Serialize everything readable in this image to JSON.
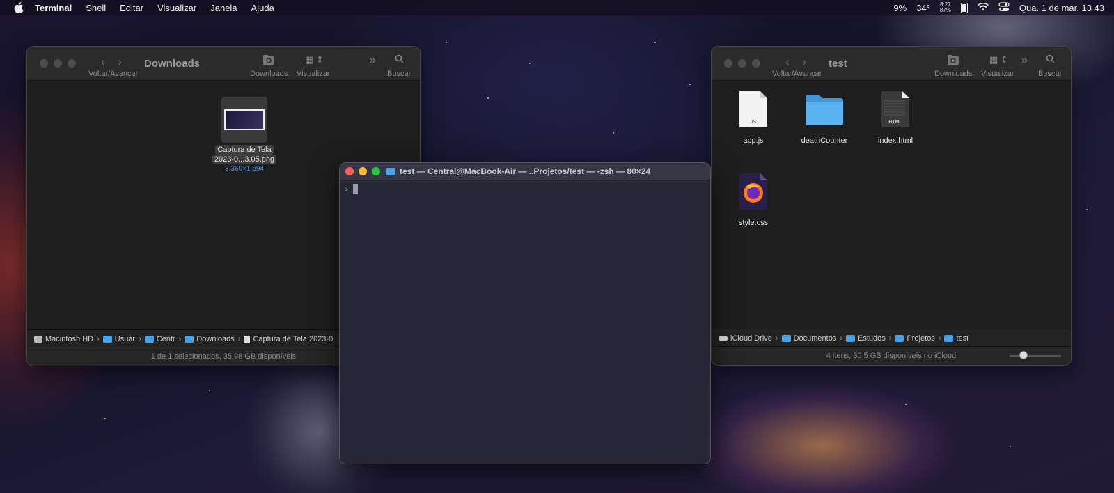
{
  "menubar": {
    "apple_icon": "apple-logo-icon",
    "app_name": "Terminal",
    "menus": [
      "Shell",
      "Editar",
      "Visualizar",
      "Janela",
      "Ajuda"
    ],
    "battery": "9%",
    "temperature": "34°",
    "stats_top": "8:27",
    "stats_bottom": "87%",
    "datetime": "Qua. 1 de mar. 13 43"
  },
  "finder_left": {
    "title": "Downloads",
    "nav_caption": "Voltar/Avançar",
    "tool_downloads": "Downloads",
    "tool_view": "Visualizar",
    "tool_search": "Buscar",
    "file": {
      "name_line1": "Captura de Tela",
      "name_line2": "2023-0...3.05.png",
      "dimensions": "3.360×1.594"
    },
    "path": [
      "Macintosh HD",
      "Usuár",
      "Centr",
      "Downloads",
      "Captura de Tela 2023-0"
    ],
    "status": "1 de 1 selecionados, 35,98 GB disponíveis"
  },
  "finder_right": {
    "title": "test",
    "nav_caption": "Voltar/Avançar",
    "tool_downloads": "Downloads",
    "tool_view": "Visualizar",
    "tool_search": "Buscar",
    "files": [
      {
        "name": "app.js",
        "badge": "JS"
      },
      {
        "name": "deathCounter"
      },
      {
        "name": "index.html",
        "badge": "HTML"
      },
      {
        "name": "style.css"
      }
    ],
    "path": [
      "iCloud Drive",
      "Documentos",
      "Estudos",
      "Projetos",
      "test"
    ],
    "status": "4 itens, 30,5 GB disponíveis no iCloud"
  },
  "terminal": {
    "title": "test — Central@MacBook-Air — ..Projetos/test — -zsh — 80×24",
    "prompt_symbol": "›"
  },
  "colors": {
    "traffic_red": "#ff5f57",
    "traffic_yellow": "#febc2e",
    "traffic_green": "#28c840",
    "folder_blue": "#4aa3e8",
    "prompt_green": "#5fd35f"
  }
}
